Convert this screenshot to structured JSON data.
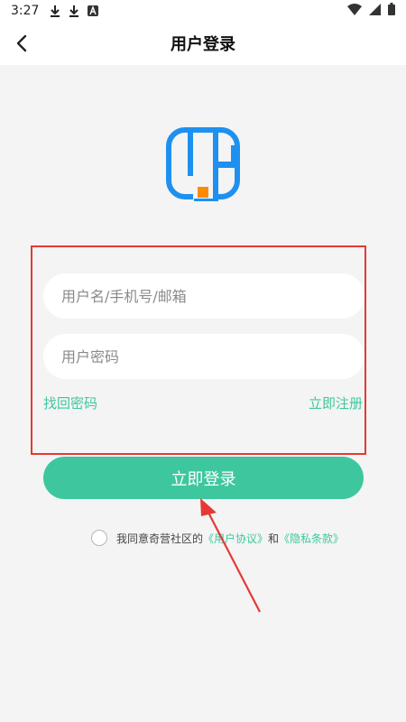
{
  "status_bar": {
    "time": "3:27",
    "icons": [
      "download-icon",
      "download-icon",
      "text-a-icon"
    ],
    "right_icons": [
      "wifi-icon",
      "signal-icon",
      "battery-icon"
    ]
  },
  "nav": {
    "title": "用户登录",
    "back_icon": "chevron-left-icon"
  },
  "logo": {
    "icon": "app-logo",
    "colors": {
      "blue": "#1e90f0",
      "orange": "#ff8a00"
    }
  },
  "form": {
    "username": {
      "value": "",
      "placeholder": "用户名/手机号/邮箱"
    },
    "password": {
      "value": "",
      "placeholder": "用户密码"
    }
  },
  "links": {
    "forgot": "找回密码",
    "register": "立即注册"
  },
  "login_button": {
    "label": "立即登录"
  },
  "agreement": {
    "checked": false,
    "prefix": "我同意奇营社区的",
    "user_agreement": "《用户协议》",
    "and": "和",
    "privacy": "《隐私条款》"
  },
  "colors": {
    "accent": "#3ec79e",
    "annotation": "#e53935",
    "background": "#f4f4f4"
  }
}
